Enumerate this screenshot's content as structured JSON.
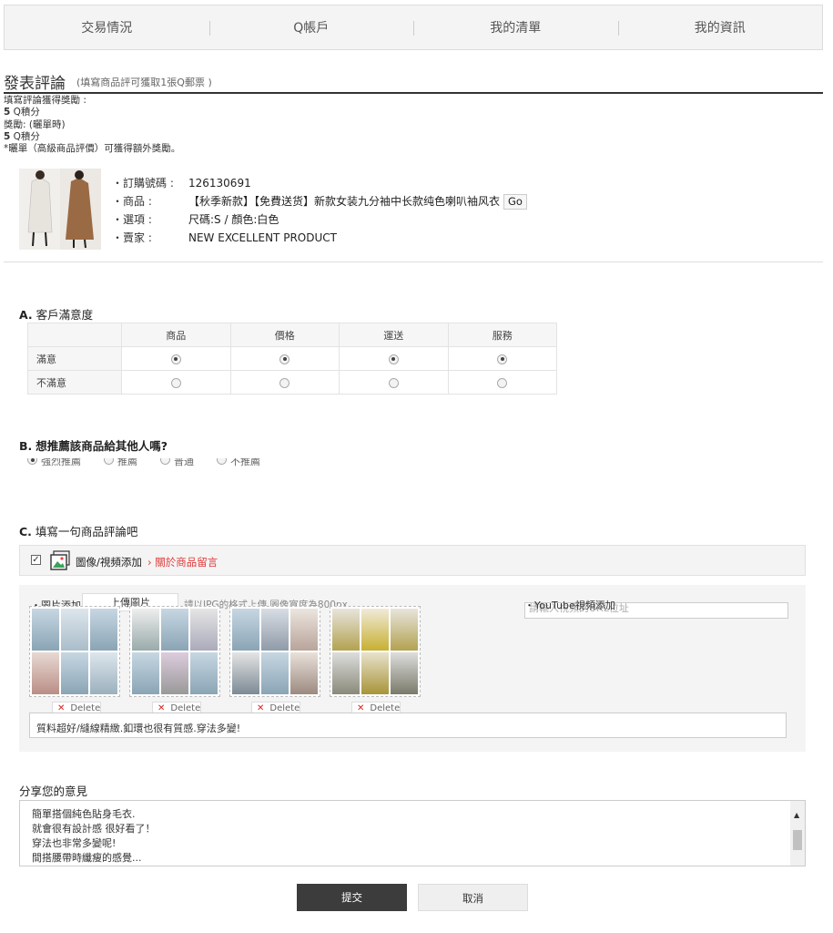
{
  "nav": {
    "tabs": [
      "交易情況",
      "Q帳戶",
      "我的清單",
      "我的資訊"
    ]
  },
  "header": {
    "title": "發表評論",
    "hint": "(填寫商品評可獲取1張Q郵票 )"
  },
  "reward": {
    "line1": "填寫評論獲得獎勵 :",
    "line2_num": "5",
    "line2_text": "Q積分",
    "line3": "獎勵: (曬單時)",
    "line4_num": "5",
    "line4_text": "Q積分",
    "line5": "*曬單（高級商品評價）可獲得額外獎勵。"
  },
  "order": {
    "order_no_label": "・訂購號碼 :",
    "order_no": "126130691",
    "product_label": "・商品 :",
    "product": "【秋季新款】【免費送货】新款女装九分袖中长款纯色喇叭袖风衣",
    "go_label": "Go",
    "option_label": "・選項 :",
    "option": "尺碼:S / 顏色:白色",
    "seller_label": "・賣家 :",
    "seller": "NEW EXCELLENT PRODUCT"
  },
  "sectionA": {
    "prefix": "A.",
    "title": "客戶滿意度",
    "columns": [
      "商品",
      "價格",
      "運送",
      "服務"
    ],
    "rows": [
      {
        "label": "滿意",
        "selected": true
      },
      {
        "label": "不滿意",
        "selected": false
      }
    ]
  },
  "sectionB": {
    "prefix": "B.",
    "title": "想推薦該商品給其他人嗎?",
    "options": [
      "強烈推薦",
      "推薦",
      "普通",
      "不推薦"
    ]
  },
  "sectionC": {
    "prefix": "C.",
    "title": "填寫一句商品評論吧",
    "media_label": "圖像/視頻添加",
    "media_link": "關於商品留言",
    "upload_label": "・圖片添加",
    "upload_button": "上傳圖片",
    "upload_hint": "請以JPG的格式上傳,圖像寬度為800px",
    "youtube_label": "・YouTube視頻添加",
    "youtube_placeholder": "請輸入視頻的URL位址",
    "delete_label": "Delete",
    "caption": "質料超好/縫線精緻.釦環也很有質感.穿法多變!"
  },
  "share": {
    "title": "分享您的意見",
    "lines": [
      "簡單搭個純色貼身毛衣.",
      "就會很有設計感 很好看了！",
      "穿法也非常多變呢!",
      "間搭腰帶時纖瘦的感覺..."
    ]
  },
  "buttons": {
    "submit": "提交",
    "cancel": "取消"
  }
}
